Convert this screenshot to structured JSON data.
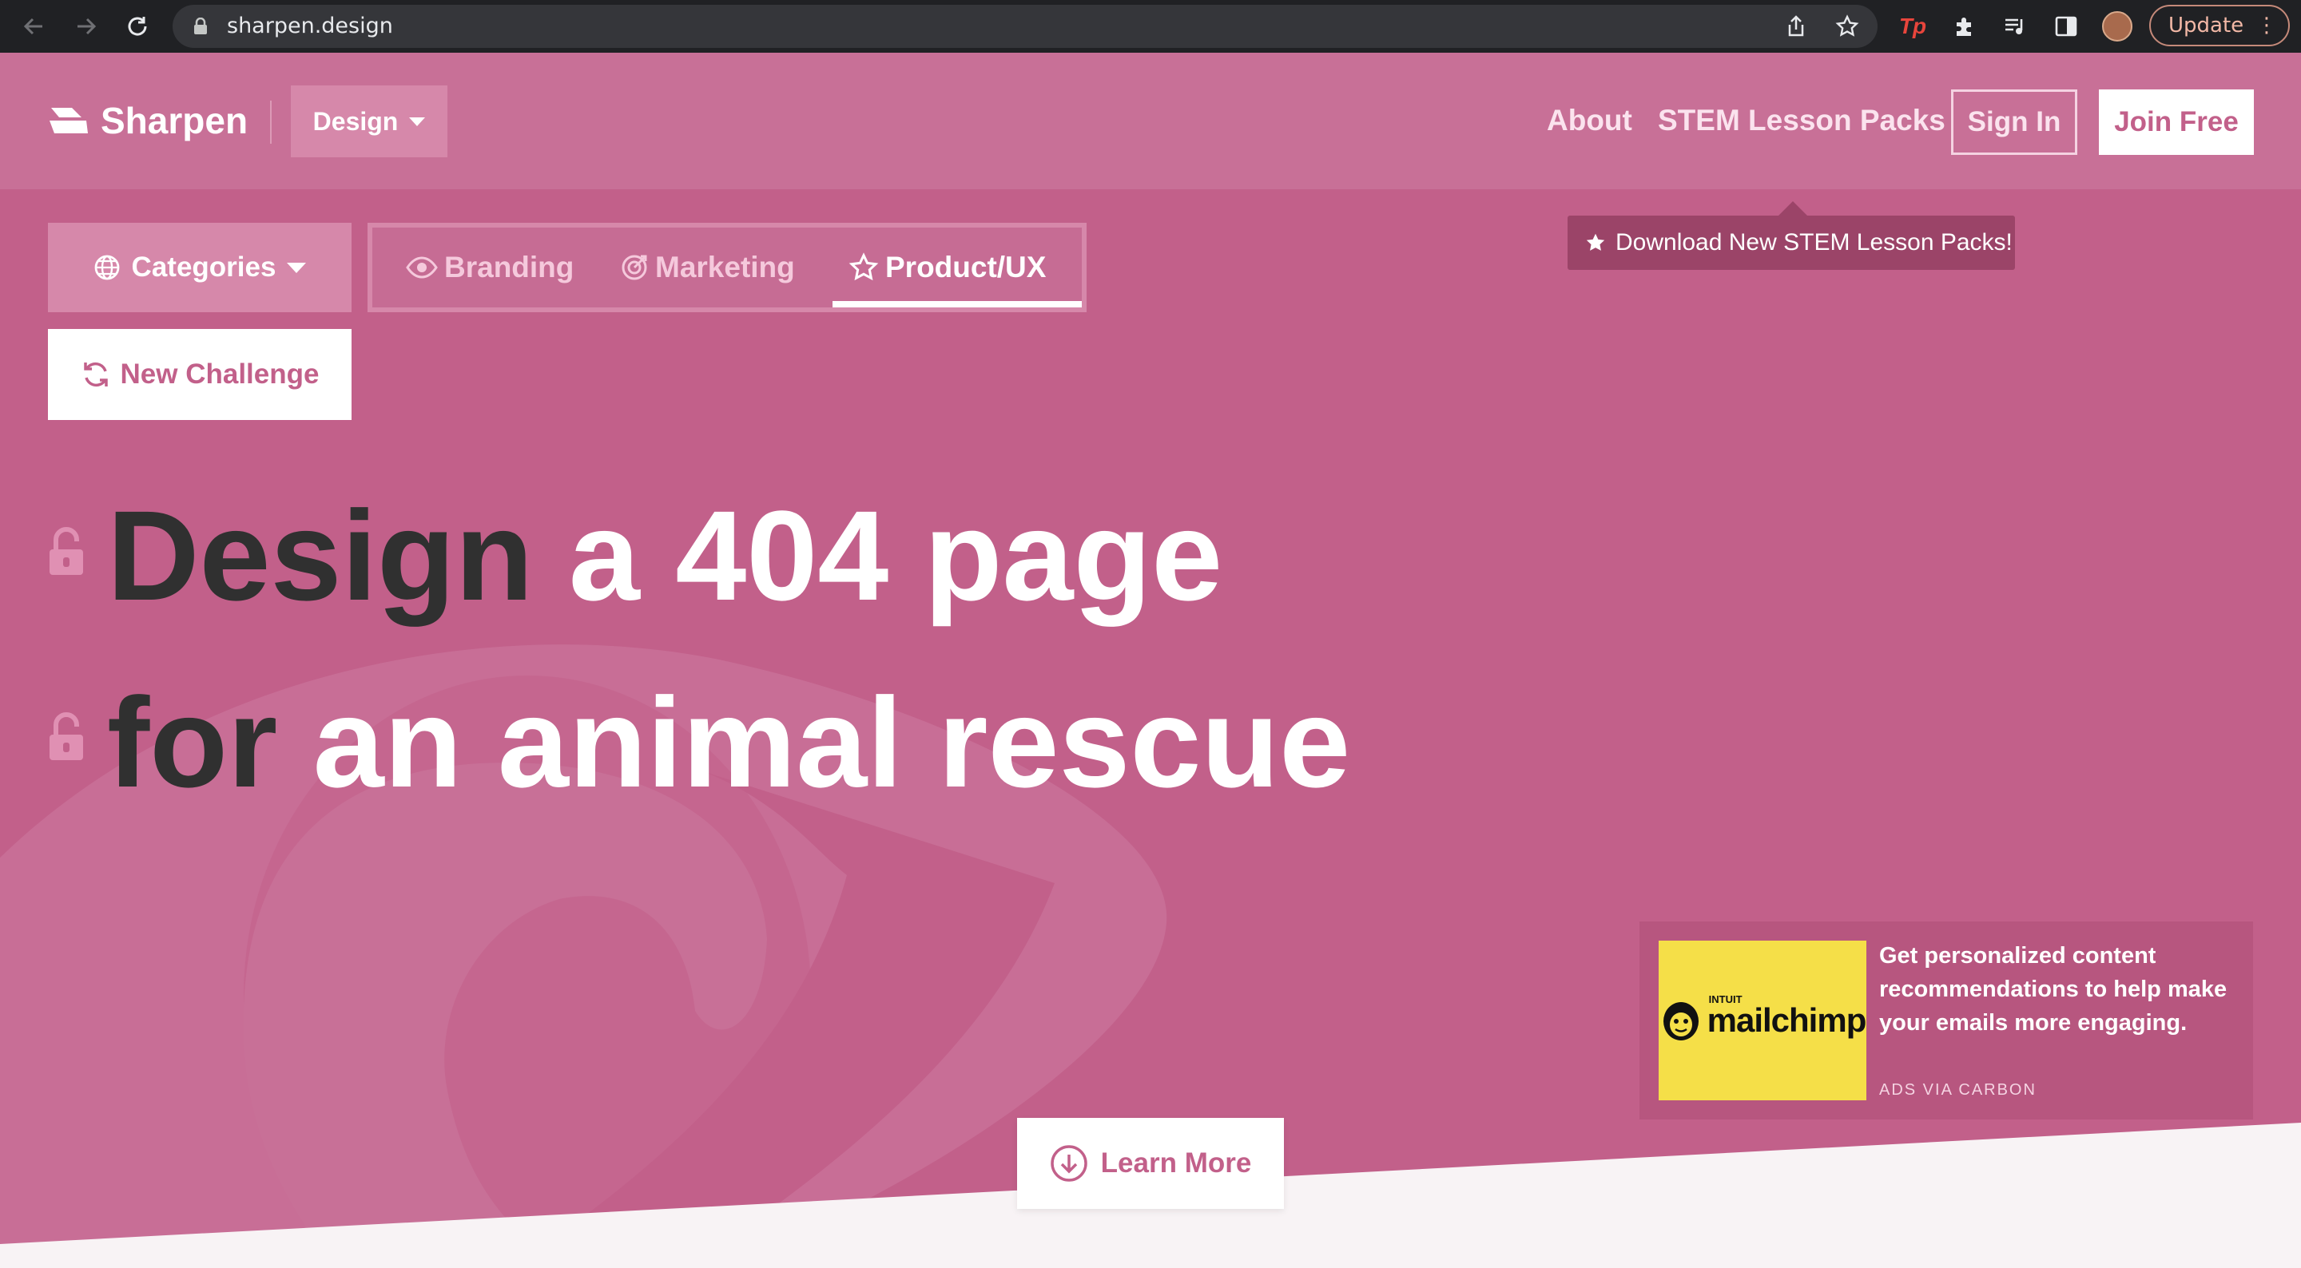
{
  "browser": {
    "url": "sharpen.design",
    "update_label": "Update",
    "extension_badge": "Tp"
  },
  "header": {
    "logo_text": "Sharpen",
    "design_dropdown": "Design",
    "nav": {
      "about": "About",
      "stem": "STEM Lesson Packs",
      "sign_in": "Sign In",
      "join_free": "Join Free"
    },
    "tooltip": "Download New STEM Lesson Packs!"
  },
  "toolbar": {
    "categories_label": "Categories",
    "tabs": [
      {
        "label": "Branding",
        "icon": "eye-icon"
      },
      {
        "label": "Marketing",
        "icon": "target-icon"
      },
      {
        "label": "Product/UX",
        "icon": "star-icon",
        "active": true
      }
    ],
    "new_challenge_label": "New Challenge"
  },
  "challenge": {
    "line1_verb": "Design",
    "line1_rest": "a 404 page",
    "line2_prep": "for",
    "line2_rest": "an animal rescue"
  },
  "ad": {
    "brand_small": "INTUIT",
    "brand": "mailchimp",
    "text": "Get personalized content recommendations to help make your emails more engaging.",
    "via": "ADS VIA CARBON"
  },
  "cta": {
    "learn_more": "Learn More"
  },
  "colors": {
    "page_bg": "#c2608a",
    "header_bg": "#c87097",
    "accent_dark": "#303030",
    "tooltip_bg": "#9b4468",
    "ad_yellow": "#f5df48"
  }
}
